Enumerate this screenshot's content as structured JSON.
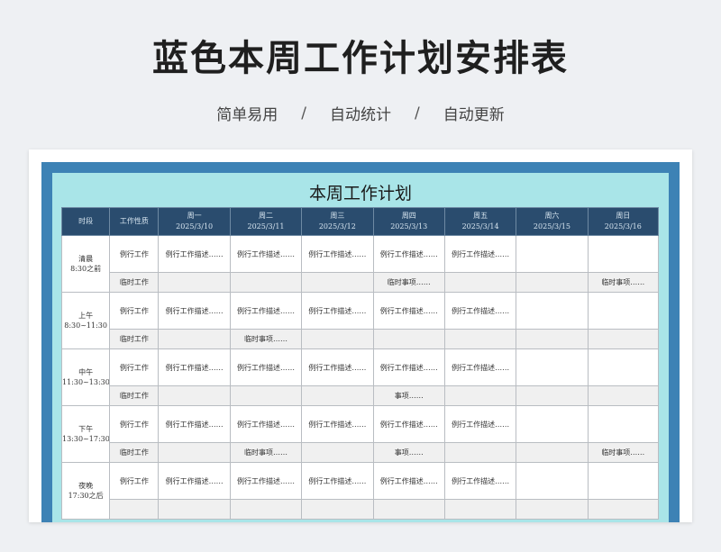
{
  "page": {
    "title": "蓝色本周工作计划安排表",
    "tags": [
      "简单易用",
      "自动统计",
      "自动更新"
    ],
    "separator": "/"
  },
  "sheet": {
    "title": "本周工作计划",
    "header_period": "时段",
    "header_nature": "工作性质",
    "days": [
      {
        "name": "周一",
        "date": "2025/3/10"
      },
      {
        "name": "周二",
        "date": "2025/3/11"
      },
      {
        "name": "周三",
        "date": "2025/3/12"
      },
      {
        "name": "周四",
        "date": "2025/3/13"
      },
      {
        "name": "周五",
        "date": "2025/3/14"
      },
      {
        "name": "周六",
        "date": "2025/3/15"
      },
      {
        "name": "周日",
        "date": "2025/3/16"
      }
    ],
    "periods": [
      {
        "name": "清晨",
        "time": "8:30之前",
        "routine_label": "例行工作",
        "routine": [
          "例行工作描述……",
          "例行工作描述……",
          "例行工作描述……",
          "例行工作描述……",
          "例行工作描述……",
          "",
          ""
        ],
        "temp_label": "临时工作",
        "temp": [
          "",
          "",
          "",
          "临时事项……",
          "",
          "",
          "临时事项……"
        ]
      },
      {
        "name": "上午",
        "time": "8:30~11:30",
        "routine_label": "例行工作",
        "routine": [
          "例行工作描述……",
          "例行工作描述……",
          "例行工作描述……",
          "例行工作描述……",
          "例行工作描述……",
          "",
          ""
        ],
        "temp_label": "临时工作",
        "temp": [
          "",
          "临时事项……",
          "",
          "",
          "",
          "",
          ""
        ]
      },
      {
        "name": "中午",
        "time": "11:30~13:30",
        "routine_label": "例行工作",
        "routine": [
          "例行工作描述……",
          "例行工作描述……",
          "例行工作描述……",
          "例行工作描述……",
          "例行工作描述……",
          "",
          ""
        ],
        "temp_label": "临时工作",
        "temp": [
          "",
          "",
          "",
          "事项……",
          "",
          "",
          ""
        ]
      },
      {
        "name": "下午",
        "time": "13:30~17:30",
        "routine_label": "例行工作",
        "routine": [
          "例行工作描述……",
          "例行工作描述……",
          "例行工作描述……",
          "例行工作描述……",
          "例行工作描述……",
          "",
          ""
        ],
        "temp_label": "临时工作",
        "temp": [
          "",
          "临时事项……",
          "",
          "事项……",
          "",
          "",
          "临时事项……"
        ]
      },
      {
        "name": "夜晚",
        "time": "17:30之后",
        "routine_label": "例行工作",
        "routine": [
          "例行工作描述……",
          "例行工作描述……",
          "例行工作描述……",
          "例行工作描述……",
          "例行工作描述……",
          "",
          ""
        ],
        "temp_label": "",
        "temp": [
          "",
          "",
          "",
          "",
          "",
          "",
          ""
        ]
      }
    ]
  }
}
